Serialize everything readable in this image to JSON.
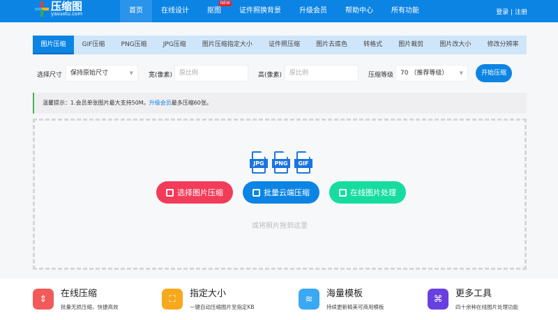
{
  "header": {
    "logo_title": "压缩图",
    "logo_domain": "yasuotu.com",
    "nav": [
      {
        "label": "首页",
        "active": true
      },
      {
        "label": "在线设计"
      },
      {
        "label": "抠图",
        "badge": "NEW"
      },
      {
        "label": "证件照换背景"
      },
      {
        "label": "升级会员"
      },
      {
        "label": "帮助中心"
      },
      {
        "label": "所有功能"
      }
    ],
    "auth": "登录 | 注册"
  },
  "tabs": [
    "图片压缩",
    "GIF压缩",
    "PNG压缩",
    "JPG压缩",
    "图片压缩指定大小",
    "证件照压缩",
    "图片去底色",
    "转格式",
    "图片裁剪",
    "图片改大小",
    "修改分辨率"
  ],
  "form": {
    "size_label": "选择尺寸",
    "size_value": "保持原始尺寸",
    "width_label": "宽(像素)",
    "width_placeholder": "原比例",
    "height_label": "高(像素)",
    "height_placeholder": "原比例",
    "level_label": "压缩等级",
    "level_value": "70 （推荐等级）",
    "start_button": "开始压缩"
  },
  "tip": {
    "text": "温馨提示：1.会员单张图片最大支持50M。",
    "link": "升级会员",
    "suffix": "最多压缩60张。",
    "accent": "#4cb050"
  },
  "drop": {
    "file_types": [
      "JPG",
      "PNG",
      "GIF"
    ],
    "buttons": [
      {
        "label": "选择图片压缩",
        "color": "#f23c5a",
        "icon": "image-icon"
      },
      {
        "label": "批量云端压缩",
        "color": "#0c84e4",
        "icon": "zip-file-icon"
      },
      {
        "label": "在线图片处理",
        "color": "#17dca0",
        "icon": "edit-image-icon"
      }
    ],
    "hint": "或将照片拖到这里"
  },
  "features": [
    {
      "title": "在线压缩",
      "desc": "批量无损压缩，快捷高效",
      "color": "#f25a5a",
      "icon": "compress-icon"
    },
    {
      "title": "指定大小",
      "desc": "一键自动压缩图片至指定KB",
      "color": "#f8a81c",
      "icon": "resize-icon"
    },
    {
      "title": "海量模板",
      "desc": "持续更新精美可商用模板",
      "color": "#3aa8f2",
      "icon": "layers-icon"
    },
    {
      "title": "更多工具",
      "desc": "四十余种在线图片处理功能",
      "color": "#6a3fe0",
      "icon": "tools-icon"
    }
  ]
}
